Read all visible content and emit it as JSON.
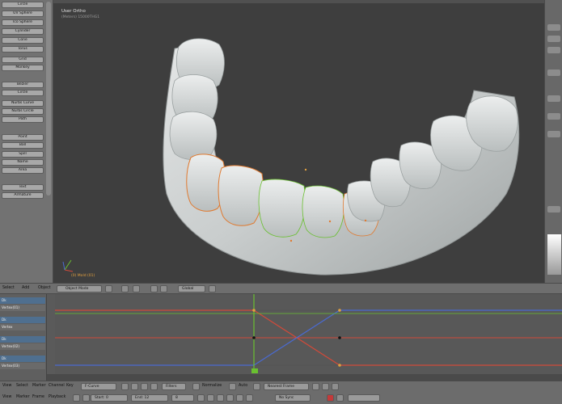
{
  "toolshelf": {
    "buttons": [
      "Circle",
      "UV Sphere",
      "Ico Sphere",
      "Cylinder",
      "Cone",
      "Torus",
      "Grid",
      "Monkey",
      "Bezier",
      "Circle",
      "Nurbs Curve",
      "Nurbs Circle",
      "Path",
      "Point",
      "Ball",
      "Spill",
      "Name",
      "Area",
      "Text",
      "Armature"
    ]
  },
  "viewport": {
    "title": "User Ortho",
    "subtitle": "(Meters) 15000THG1",
    "object_label": "(0) Mold (01)"
  },
  "view_header": {
    "select": "Select",
    "add": "Add",
    "object": "Object",
    "mode": "Object Mode",
    "orientation": "Global"
  },
  "channels": [
    {
      "label": "Dk",
      "kind": "grp"
    },
    {
      "label": "Vertex(01)",
      "kind": "sub"
    },
    {
      "label": "Dk",
      "kind": "grp"
    },
    {
      "label": "Vertex",
      "kind": "sub"
    },
    {
      "label": "Dk",
      "kind": "grp"
    },
    {
      "label": "Vertex(02)",
      "kind": "sub"
    },
    {
      "label": "Dk",
      "kind": "grp"
    },
    {
      "label": "Vertex(03)",
      "kind": "sub"
    }
  ],
  "graph_header": {
    "view": "View",
    "select": "Select",
    "marker": "Marker",
    "channel": "Channel",
    "key": "Key",
    "mode": "F-Curve",
    "filters": "Filters",
    "normalize": "Normalize",
    "auto": "Auto",
    "snap": "Nearest Frame"
  },
  "timeline_header": {
    "view": "View",
    "marker": "Marker",
    "frame": "Frame",
    "playback": "Playback",
    "start": "Start:",
    "start_value": "0",
    "end": "End:",
    "end_value": "12",
    "current": "8",
    "sync": "No Sync"
  },
  "colors": {
    "curve_red": "#d04a3a",
    "curve_blue": "#4a6ad0",
    "curve_green": "#6ac030",
    "selection": "#e07a30"
  }
}
